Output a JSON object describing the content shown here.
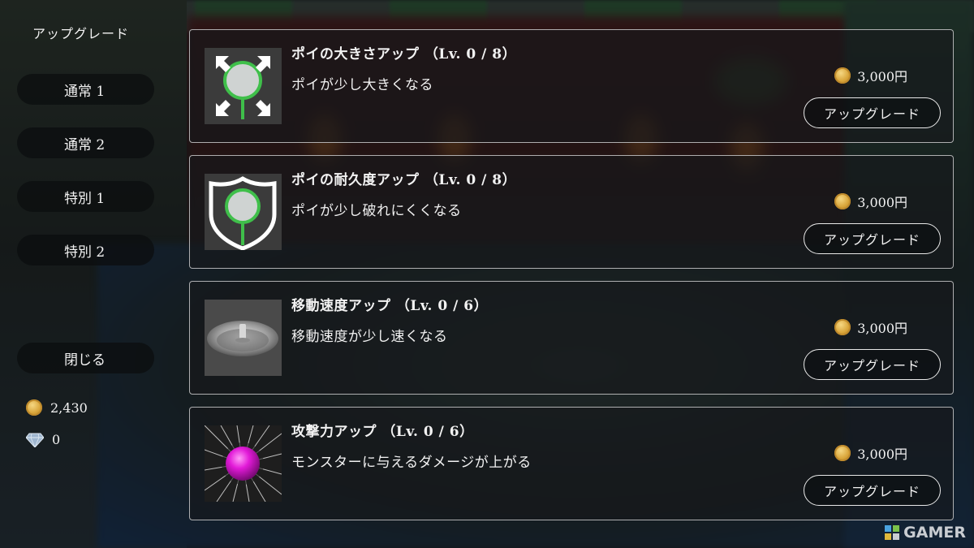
{
  "sidebar": {
    "title": "アップグレード",
    "tabs": [
      {
        "label": "通常 1"
      },
      {
        "label": "通常 2"
      },
      {
        "label": "特別 1"
      },
      {
        "label": "特別 2"
      }
    ],
    "close_label": "閉じる",
    "coins": "2,430",
    "gems": "0"
  },
  "upgrades": [
    {
      "name": "ポイの大きさアップ （Lv. 0 / 8）",
      "desc": "ポイが少し大きくなる",
      "price": "3,000円",
      "button": "アップグレード",
      "icon": "poi-enlarge-icon"
    },
    {
      "name": "ポイの耐久度アップ （Lv. 0 / 8）",
      "desc": "ポイが少し破れにくくなる",
      "price": "3,000円",
      "button": "アップグレード",
      "icon": "poi-shield-icon"
    },
    {
      "name": "移動速度アップ （Lv. 0 / 6）",
      "desc": "移動速度が少し速くなる",
      "price": "3,000円",
      "button": "アップグレード",
      "icon": "speed-dish-icon"
    },
    {
      "name": "攻撃力アップ （Lv. 0 / 6）",
      "desc": "モンスターに与えるダメージが上がる",
      "price": "3,000円",
      "button": "アップグレード",
      "icon": "attack-orb-icon"
    }
  ],
  "watermark": {
    "text": "GAMER"
  },
  "colors": {
    "poi_green": "#3fbf4a",
    "coin_gold": "#d9a53a",
    "attack_magenta": "#e21ad8"
  }
}
